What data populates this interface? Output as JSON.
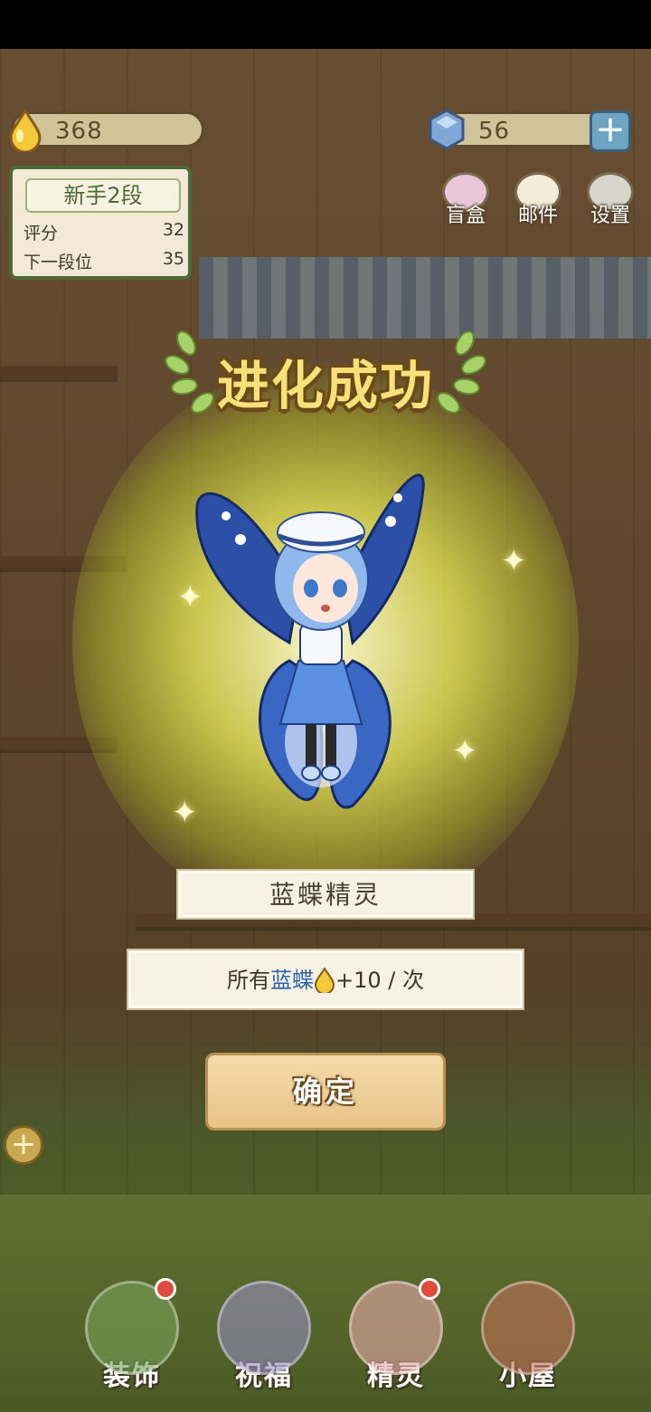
{
  "resources": {
    "drops": "368",
    "gems": "56"
  },
  "rank": {
    "title": "新手2段",
    "score_label": "评分",
    "score_value": "32",
    "next_label": "下一段位",
    "next_value": "35"
  },
  "top_buttons": [
    {
      "label": "盲盒",
      "icon": "gift-box-icon"
    },
    {
      "label": "邮件",
      "icon": "mail-icon"
    },
    {
      "label": "设置",
      "icon": "gear-icon"
    }
  ],
  "popup": {
    "title": "进化成功",
    "fairy_name": "蓝蝶精灵",
    "effect_prefix": "所有",
    "effect_highlight": "蓝蝶",
    "effect_suffix": "+10 / 次",
    "confirm_label": "确定"
  },
  "nav": [
    {
      "label": "装饰",
      "icon": "plant-icon",
      "badge": true
    },
    {
      "label": "祝福",
      "icon": "butterfly-icon",
      "badge": false
    },
    {
      "label": "精灵",
      "icon": "fairy-icon",
      "badge": true
    },
    {
      "label": "小屋",
      "icon": "house-icon",
      "badge": false
    }
  ],
  "colors": {
    "title_gold": "#f7e27a",
    "highlight_blue": "#2f62b0",
    "badge_red": "#e04a3a"
  }
}
